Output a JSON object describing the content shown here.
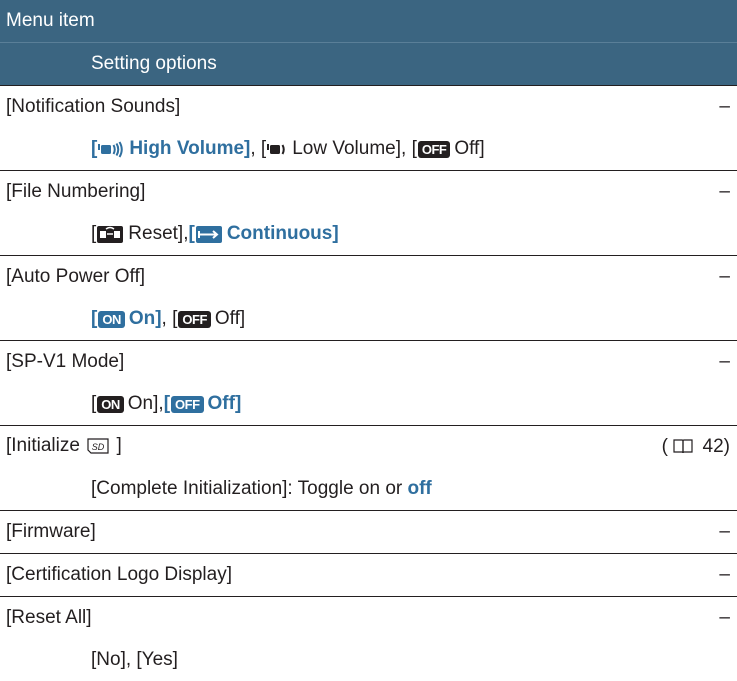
{
  "header": {
    "col1": "Menu item",
    "col2": "Setting options"
  },
  "items": [
    {
      "label": "[Notification Sounds]",
      "ref": "–",
      "options": {
        "o1_pre": "[",
        "o1_label": "High Volume]",
        "sep1": ", [",
        "o2_label": "Low Volume], [",
        "o3_badge": "OFF",
        "o3_label": "Off]"
      }
    },
    {
      "label": "[File Numbering]",
      "ref": "–",
      "options": {
        "o1_pre": "[",
        "o1_label": "Reset], ",
        "o2_pre": "[",
        "o2_label": "Continuous]"
      }
    },
    {
      "label": "[Auto Power Off]",
      "ref": "–",
      "options": {
        "o1_pre": "[",
        "o1_badge": "ON",
        "o1_label": "On]",
        "sep": ", [",
        "o2_badge": "OFF",
        "o2_label": "Off]"
      }
    },
    {
      "label": "[SP-V1 Mode]",
      "ref": "–",
      "options": {
        "o1_pre": "[",
        "o1_badge": "ON",
        "o1_label": "On], ",
        "o2_pre": "[",
        "o2_badge": "OFF",
        "o2_label": "Off]"
      }
    },
    {
      "label_pre": "[Initialize",
      "label_post": "]",
      "sd_text": "SD",
      "ref_open": "(",
      "ref_page": "42)",
      "options": {
        "text": "[Complete Initialization]: Toggle on or",
        "highlight": "off"
      }
    },
    {
      "label": "[Firmware]",
      "ref": "–"
    },
    {
      "label": "[Certification Logo Display]",
      "ref": "–"
    },
    {
      "label": "[Reset All]",
      "ref": "–",
      "options": {
        "text": "[No], [Yes]"
      }
    }
  ],
  "colors": {
    "header_bg": "#3b6581",
    "accent_blue": "#2f6f9f",
    "text": "#231f20"
  },
  "icons": [
    "high-volume-icon",
    "low-volume-icon",
    "reset-numbering-icon",
    "continuous-numbering-icon",
    "sd-card-icon",
    "book-reference-icon"
  ]
}
